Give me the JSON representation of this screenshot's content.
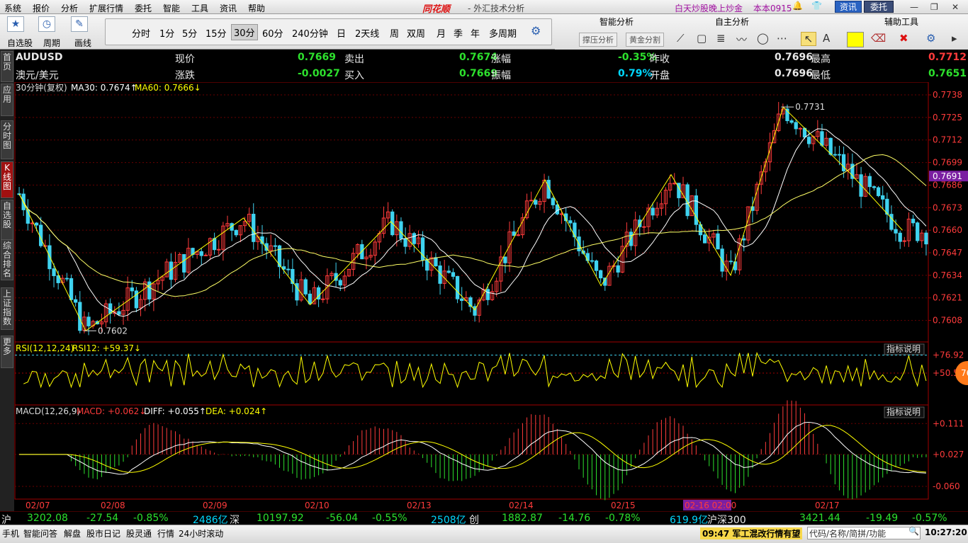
{
  "menu": {
    "items": [
      "系统",
      "报价",
      "分析",
      "扩展行情",
      "委托",
      "智能",
      "工具",
      "资讯",
      "帮助"
    ],
    "brand": "同花顺",
    "brand_sub": "- 外汇技术分析",
    "promo": "白天炒股晚上炒金",
    "user": "本本0915",
    "news_btn": "资讯",
    "trade_btn": "委托"
  },
  "toolbar": {
    "labels": [
      "自选股",
      "周期",
      "画线"
    ],
    "periods": [
      "分时",
      "1分",
      "5分",
      "15分",
      "30分",
      "60分",
      "240分钟",
      "日",
      "2天线",
      "周",
      "双周",
      "月",
      "季",
      "年",
      "多周期"
    ],
    "active_period": "30分"
  },
  "right_panel": {
    "headers": [
      "智能分析",
      "自主分析",
      "辅助工具"
    ],
    "buttons": [
      "撑压分析",
      "黄金分割"
    ]
  },
  "sidebar": {
    "tabs": [
      "首页",
      "应用",
      "分时图",
      "K线图",
      "自选股",
      "综合排名",
      "上证指数",
      "更多"
    ],
    "active": "K线图"
  },
  "quote": {
    "symbol": "AUDUSD",
    "name": "澳元/美元",
    "fields": [
      {
        "label": "现价",
        "value": "0.7669",
        "color": "#2de12d"
      },
      {
        "label": "卖出",
        "value": "0.7674",
        "color": "#2de12d"
      },
      {
        "label": "涨幅",
        "value": "-0.35%",
        "color": "#2de12d"
      },
      {
        "label": "昨收",
        "value": "0.7696",
        "color": "#e8e8e8"
      },
      {
        "label": "最高",
        "value": "0.7712",
        "color": "#ff3b3b"
      },
      {
        "label": "涨跌",
        "value": "-0.0027",
        "color": "#2de12d"
      },
      {
        "label": "买入",
        "value": "0.7669",
        "color": "#2de12d"
      },
      {
        "label": "振幅",
        "value": "0.79%",
        "color": "#00d8ff"
      },
      {
        "label": "开盘",
        "value": "0.7696",
        "color": "#e8e8e8"
      },
      {
        "label": "最低",
        "value": "0.7651",
        "color": "#2de12d"
      }
    ]
  },
  "main_chart": {
    "header": "30分钟(复权)",
    "ma30": "MA30: 0.7674",
    "ma60": "MA60: 0.7666",
    "y_ticks": [
      "0.7738",
      "0.7725",
      "0.7712",
      "0.7699",
      "0.7686",
      "0.7673",
      "0.7660",
      "0.7647",
      "0.7634",
      "0.7621",
      "0.7608"
    ],
    "current_price": "0.7691",
    "high_mark": "0.7731",
    "low_mark": "0.7602"
  },
  "rsi": {
    "header": "RSI(12,12,24)",
    "value": "RSI12: +59.37",
    "ticks": [
      "+76.92",
      "+50.53"
    ],
    "explain": "指标说明",
    "badge": "76"
  },
  "macd": {
    "header": "MACD(12,26,9)",
    "macd": "MACD: +0.062",
    "diff": "DIFF: +0.055",
    "dea": "DEA: +0.024",
    "ticks": [
      "+0.111",
      "+0.027",
      "-0.060"
    ],
    "explain": "指标说明"
  },
  "x_axis": {
    "dates": [
      "02/07",
      "02/08",
      "02/09",
      "02/10",
      "02/13",
      "02/14",
      "02/15",
      "02-16 02:00",
      "02/17"
    ]
  },
  "chart_data": {
    "type": "candlestick",
    "title": "AUDUSD 30分钟",
    "ylim": [
      0.7596,
      0.7738
    ],
    "high": 0.7731,
    "low": 0.7602,
    "last": 0.7691,
    "ma30": 0.7674,
    "ma60": 0.7666,
    "rsi12": 59.37,
    "macd": 0.062,
    "diff": 0.055,
    "dea": 0.024,
    "dates": [
      "02/07",
      "02/08",
      "02/09",
      "02/10",
      "02/13",
      "02/14",
      "02/15",
      "02/16",
      "02/17"
    ],
    "zigzag": [
      0.7681,
      0.7602,
      0.7667,
      0.7617,
      0.7665,
      0.7614,
      0.7689,
      0.7628,
      0.7692,
      0.7634,
      0.7731,
      0.7693,
      0.766
    ]
  },
  "status": {
    "items": [
      {
        "t": "沪",
        "c": "#e8e8e8"
      },
      {
        "t": "3202.08",
        "c": "#2de12d"
      },
      {
        "t": "-27.54",
        "c": "#2de12d"
      },
      {
        "t": "-0.85%",
        "c": "#2de12d"
      },
      {
        "t": "2486亿",
        "c": "#00d8ff"
      },
      {
        "t": "深",
        "c": "#e8e8e8"
      },
      {
        "t": "10197.92",
        "c": "#2de12d"
      },
      {
        "t": "-56.04",
        "c": "#2de12d"
      },
      {
        "t": "-0.55%",
        "c": "#2de12d"
      },
      {
        "t": "2508亿",
        "c": "#00d8ff"
      },
      {
        "t": "创",
        "c": "#e8e8e8"
      },
      {
        "t": "1882.87",
        "c": "#2de12d"
      },
      {
        "t": "-14.76",
        "c": "#2de12d"
      },
      {
        "t": "-0.78%",
        "c": "#2de12d"
      },
      {
        "t": "619.9亿",
        "c": "#00d8ff"
      },
      {
        "t": "沪深300",
        "c": "#e8e8e8"
      },
      {
        "t": "3421.44",
        "c": "#2de12d"
      },
      {
        "t": "-19.49",
        "c": "#2de12d"
      },
      {
        "t": "-0.57%",
        "c": "#2de12d"
      }
    ]
  },
  "bottom": {
    "items": [
      "手机",
      "智能问答",
      "解盘",
      "股市日记",
      "股灵通",
      "行情",
      "24小时滚动"
    ],
    "news": "09:47 军工混改行情有望",
    "search_placeholder": "代码/名称/简拼/功能",
    "clock": "10:27:20"
  }
}
